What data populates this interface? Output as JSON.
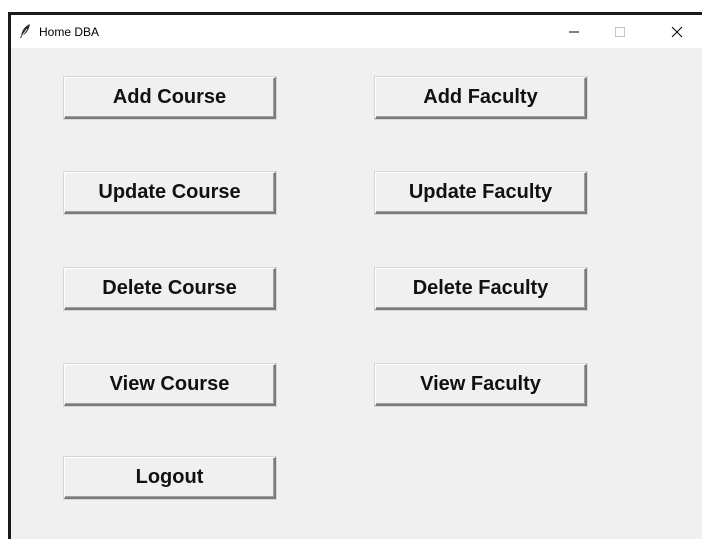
{
  "window": {
    "title": "Home DBA",
    "icon": "feather-icon",
    "controls": {
      "minimize": "minimize-icon",
      "maximize": "maximize-icon",
      "close": "close-icon"
    }
  },
  "buttons": {
    "add_course": "Add Course",
    "add_faculty": "Add Faculty",
    "update_course": "Update Course",
    "update_faculty": "Update Faculty",
    "delete_course": "Delete Course",
    "delete_faculty": "Delete Faculty",
    "view_course": "View Course",
    "view_faculty": "View Faculty",
    "logout": "Logout"
  },
  "colors": {
    "window_background": "#f0f0f0",
    "titlebar_background": "#ffffff",
    "text": "#111111"
  }
}
